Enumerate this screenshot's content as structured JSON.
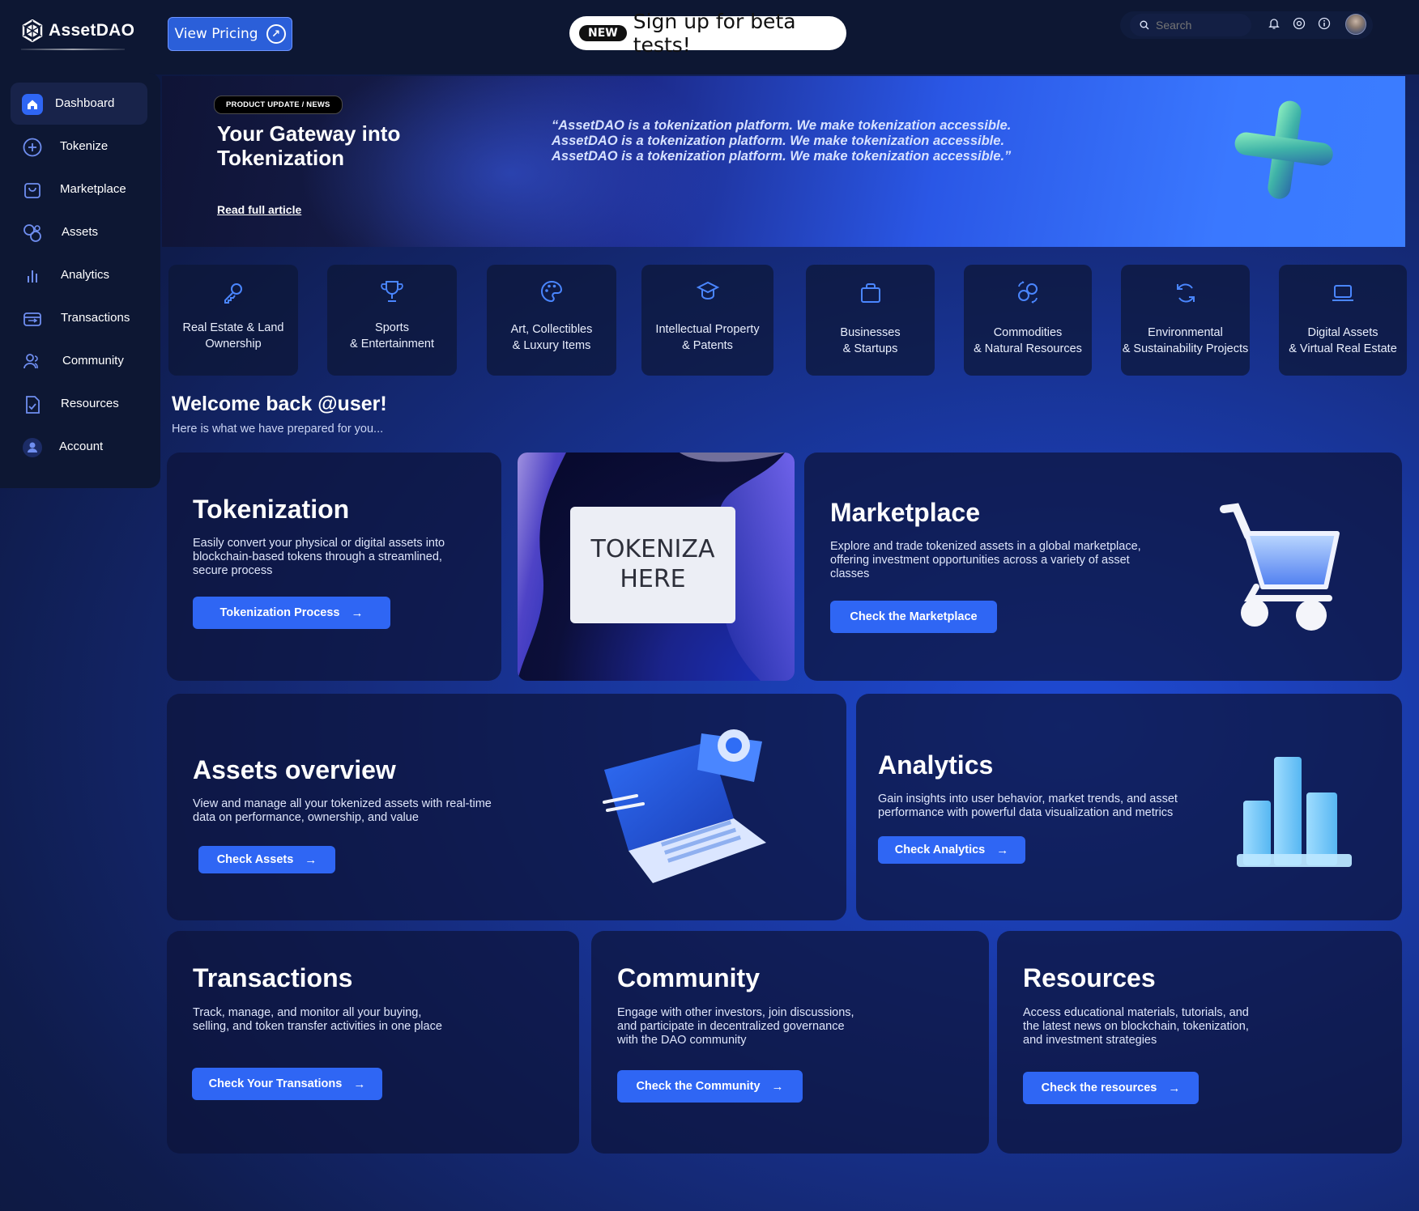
{
  "app": {
    "name": "AssetDAO"
  },
  "header": {
    "view_pricing": "View Pricing",
    "beta_badge": "NEW",
    "beta_text": "Sign up for beta tests!",
    "search_placeholder": "Search"
  },
  "sidebar": {
    "items": [
      {
        "label": "Dashboard",
        "icon": "home-icon",
        "active": true
      },
      {
        "label": "Tokenize",
        "icon": "plus-circle-icon"
      },
      {
        "label": "Marketplace",
        "icon": "shopping-bag-icon"
      },
      {
        "label": "Assets",
        "icon": "assets-icon"
      },
      {
        "label": "Analytics",
        "icon": "bar-chart-icon"
      },
      {
        "label": "Transactions",
        "icon": "transactions-icon"
      },
      {
        "label": "Community",
        "icon": "users-icon"
      },
      {
        "label": "Resources",
        "icon": "document-icon"
      },
      {
        "label": "Account",
        "icon": "user-icon"
      }
    ]
  },
  "hero": {
    "badge": "PRODUCT UPDATE / NEWS",
    "title": "Your Gateway into Tokenization",
    "link": "Read full article",
    "quote": "“AssetDAO is a tokenization platform. We make tokenization accessible. AssetDAO is a tokenization platform. We make tokenization accessible. AssetDAO is a tokenization platform. We make tokenization accessible.”"
  },
  "categories": [
    {
      "label": "Real Estate & Land\nOwnership",
      "icon": "key-icon"
    },
    {
      "label": "Sports\n& Entertainment",
      "icon": "trophy-icon"
    },
    {
      "label": "Art, Collectibles\n& Luxury Items",
      "icon": "palette-icon"
    },
    {
      "label": "Intellectual Property\n& Patents",
      "icon": "graduation-cap-icon"
    },
    {
      "label": "Businesses\n& Startups",
      "icon": "briefcase-icon"
    },
    {
      "label": "Commodities\n& Natural Resources",
      "icon": "exchange-icon"
    },
    {
      "label": "Environmental\n& Sustainability Projects",
      "icon": "recycle-icon"
    },
    {
      "label": "Digital Assets\n& Virtual Real Estate",
      "icon": "laptop-icon"
    }
  ],
  "welcome": {
    "title": "Welcome back @user!",
    "subtitle": "Here is what we have prepared for you..."
  },
  "cards": {
    "tokenization": {
      "title": "Tokenization",
      "desc": "Easily convert your physical or digital assets into blockchain-based tokens through a streamlined, secure process",
      "button": "Tokenization Process",
      "image_text": "TOKENIZA\nHERE"
    },
    "marketplace": {
      "title": "Marketplace",
      "desc": "Explore and trade tokenized assets in a global marketplace, offering investment opportunities across a variety of asset classes",
      "button": "Check the Marketplace"
    },
    "assets": {
      "title": "Assets overview",
      "desc": "View and manage all your tokenized assets with real-time data on performance, ownership, and value",
      "button": "Check Assets"
    },
    "analytics": {
      "title": "Analytics",
      "desc": "Gain insights into user behavior, market trends, and asset performance with powerful data visualization and metrics",
      "button": "Check Analytics"
    },
    "transactions": {
      "title": "Transactions",
      "desc": "Track, manage, and monitor all your buying, selling, and token transfer activities in one place",
      "button": "Check Your Transations"
    },
    "community": {
      "title": "Community",
      "desc": "Engage with other investors, join discussions, and participate in decentralized governance with the DAO community",
      "button": "Check the Community"
    },
    "resources": {
      "title": "Resources",
      "desc": "Access educational materials, tutorials, and the latest news on blockchain, tokenization, and investment strategies",
      "button": "Check the resources"
    }
  },
  "colors": {
    "accent": "#2f66f4",
    "nav_bg": "#0d1733",
    "hero_blue": "#3b7dff"
  }
}
